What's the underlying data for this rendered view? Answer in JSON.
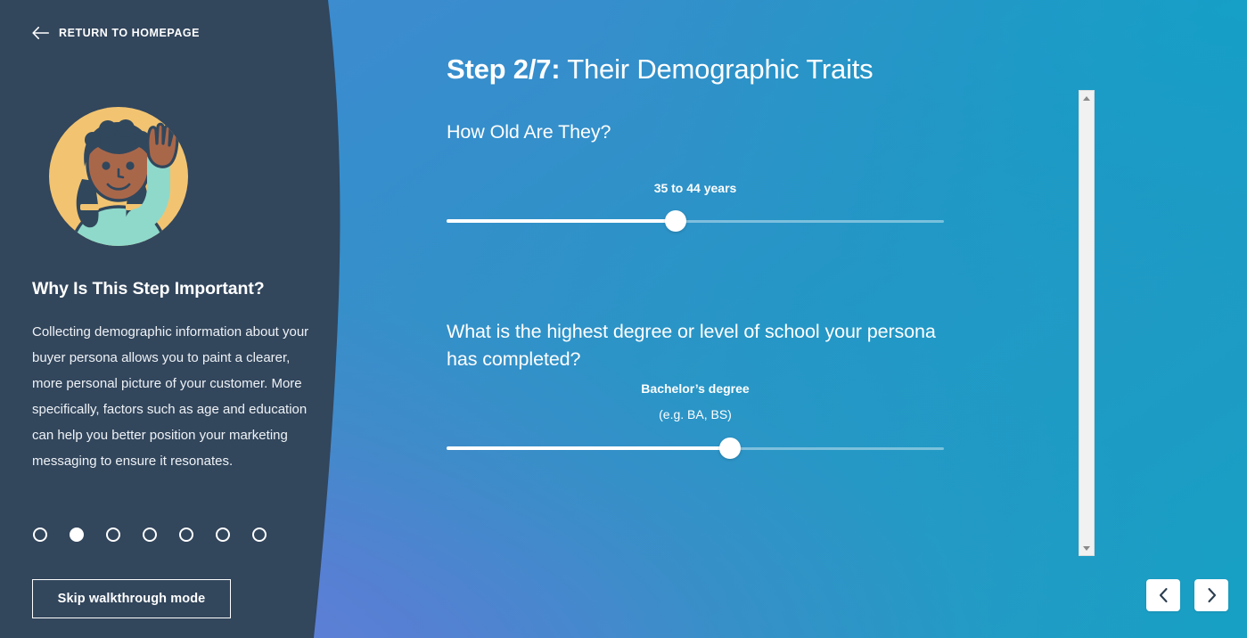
{
  "sidebar": {
    "return_link": {
      "label": "RETURN TO HOMEPAGE",
      "icon": "arrow-left-icon"
    },
    "illustration": {
      "name": "waving-person-illustration",
      "circle_color": "#f2c471",
      "skin_color": "#a9674a",
      "hair_color": "#31475c",
      "shirt_color": "#8fd9cb"
    },
    "heading": "Why Is This Step Important?",
    "body": "Collecting demographic information about your buyer persona allows you to paint a clearer, more personal picture of your customer. More specifically, factors such as age and education can help you better position your marketing messaging to ensure it resonates.",
    "steps": {
      "total": 7,
      "active_index": 2,
      "dots": [
        1,
        2,
        3,
        4,
        5,
        6,
        7
      ]
    },
    "skip_button_label": "Skip walkthrough mode",
    "background_color": "#32465c"
  },
  "main": {
    "title": {
      "step_prefix": "Step 2/7:",
      "step_name": " Their Demographic Traits"
    },
    "questions": [
      {
        "text": "How Old Are They?",
        "value_label": "35 to 44 years",
        "value_sub_label": "",
        "slider_percent": 46
      },
      {
        "text": "What is the highest degree or level of school your persona has completed?",
        "value_label": "Bachelor’s degree",
        "value_sub_label": "(e.g. BA, BS)",
        "slider_percent": 57
      }
    ]
  },
  "scrollbar": {
    "up_arrow": "scroll-up-arrow-icon",
    "down_arrow": "scroll-down-arrow-icon"
  },
  "nav": {
    "previous_label": "‹",
    "next_label": "›"
  },
  "colors": {
    "sidebar_bg": "#32465c",
    "gradient_top_right": "#16a0c4",
    "gradient_bottom_left": "#6679d6",
    "accent_white": "#ffffff",
    "nav_chevron": "#2c3e50"
  }
}
